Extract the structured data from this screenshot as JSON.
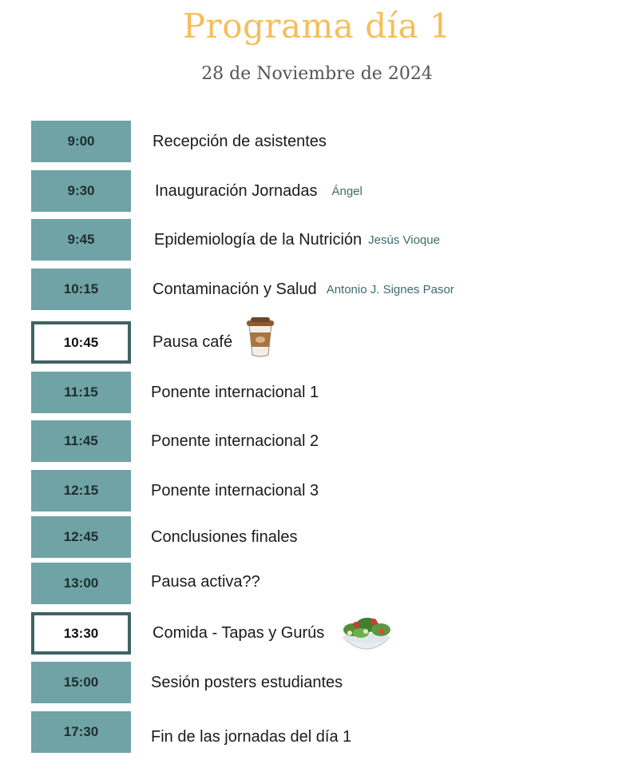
{
  "header": {
    "title": "Programa día 1",
    "date": "28 de Noviembre de 2024"
  },
  "colors": {
    "title": "#f6bd59",
    "time_block": "#6fa3a5",
    "time_outline": "#3f6365",
    "speaker": "#3e6b6e"
  },
  "schedule": [
    {
      "time": "9:00",
      "title": "Recepción de asistentes",
      "speaker": ""
    },
    {
      "time": "9:30",
      "title": "Inauguración Jornadas",
      "speaker": "Ángel"
    },
    {
      "time": "9:45",
      "title": "Epidemiología de la Nutrición",
      "speaker": "Jesús Vioque"
    },
    {
      "time": "10:15",
      "title": "Contaminación y Salud",
      "speaker": "Antonio J. Signes Pasor"
    },
    {
      "time": "10:45",
      "title": "Pausa café",
      "speaker": "",
      "icon": "coffee-cup-icon"
    },
    {
      "time": "11:15",
      "title": "Ponente internacional 1",
      "speaker": ""
    },
    {
      "time": "11:45",
      "title": "Ponente internacional 2",
      "speaker": ""
    },
    {
      "time": "12:15",
      "title": "Ponente internacional 3",
      "speaker": ""
    },
    {
      "time": "12:45",
      "title": "Conclusiones finales",
      "speaker": ""
    },
    {
      "time": "13:00",
      "title": "Pausa activa??",
      "speaker": ""
    },
    {
      "time": "13:30",
      "title": "Comida - Tapas y Gurús",
      "speaker": "",
      "icon": "salad-bowl-icon"
    },
    {
      "time": "15:00",
      "title": "Sesión posters estudiantes",
      "speaker": ""
    },
    {
      "time": "17:30",
      "title": "Fin de las jornadas del día 1",
      "speaker": ""
    }
  ]
}
